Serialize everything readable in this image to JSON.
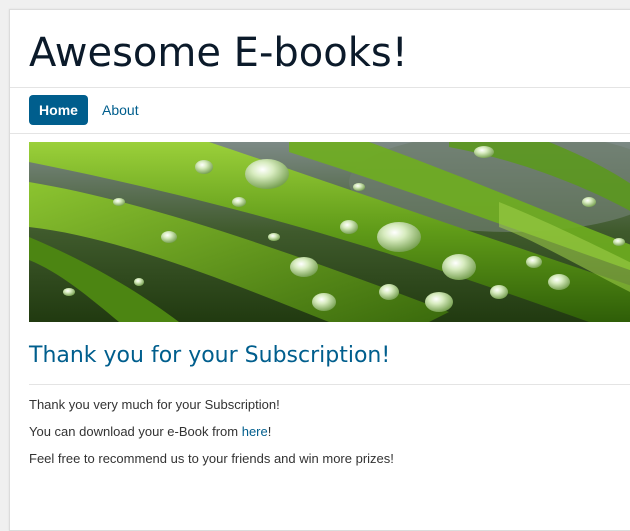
{
  "site": {
    "title": "Awesome E-books!"
  },
  "nav": {
    "items": [
      {
        "label": "Home",
        "active": true
      },
      {
        "label": "About",
        "active": false
      }
    ]
  },
  "banner": {
    "subject": "green grass blades with water droplets"
  },
  "content": {
    "heading": "Thank you for your Subscription!",
    "p1": "Thank you very much for your Subscription!",
    "p2_before": "You can download your e-Book from ",
    "p2_link": "here",
    "p2_after": "!",
    "p3": "Feel free to recommend us to your friends and win more prizes!"
  },
  "colors": {
    "accent": "#005e8d",
    "title": "#0b1a2a",
    "body_text": "#333333"
  }
}
